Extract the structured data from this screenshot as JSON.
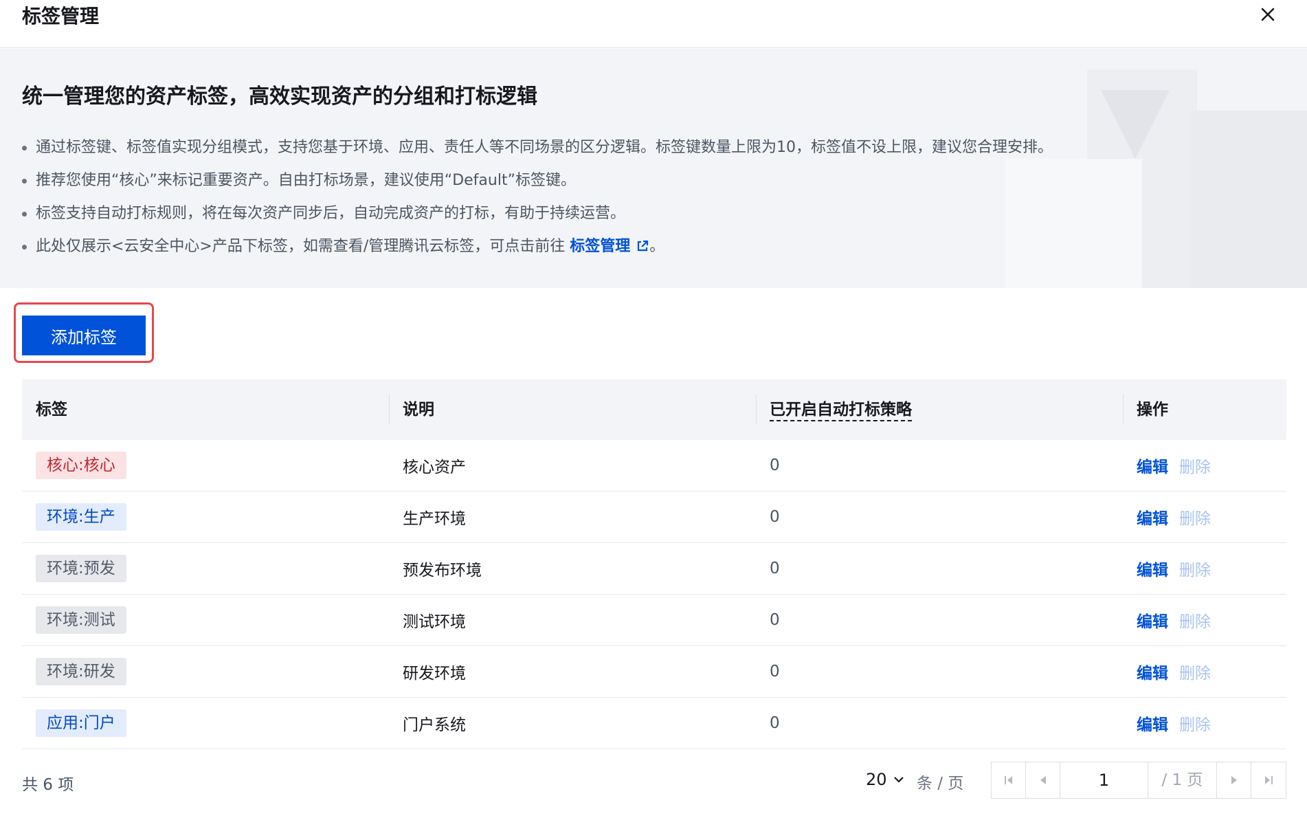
{
  "dialog": {
    "title": "标签管理"
  },
  "banner": {
    "heading": "统一管理您的资产标签，高效实现资产的分组和打标逻辑",
    "bullets": [
      "通过标签键、标签值实现分组模式，支持您基于环境、应用、责任人等不同场景的区分逻辑。标签键数量上限为10，标签值不设上限，建议您合理安排。",
      "推荐您使用“核心”来标记重要资产。自由打标场景，建议使用“Default”标签键。",
      "标签支持自动打标规则，将在每次资产同步后，自动完成资产的打标，有助于持续运营。"
    ],
    "last_bullet_prefix": "此处仅展示<云安全中心>产品下标签，如需查看/管理腾讯云标签，可点击前往 ",
    "last_bullet_link": "标签管理",
    "last_bullet_suffix": "。"
  },
  "toolbar": {
    "add_label": "添加标签"
  },
  "table": {
    "headers": [
      "标签",
      "说明",
      "已开启自动打标策略",
      "操作"
    ],
    "rows": [
      {
        "tag": "核心:核心",
        "tag_color": "red",
        "desc": "核心资产",
        "count": "0",
        "edit": "编辑",
        "delete": "删除"
      },
      {
        "tag": "环境:生产",
        "tag_color": "blue",
        "desc": "生产环境",
        "count": "0",
        "edit": "编辑",
        "delete": "删除"
      },
      {
        "tag": "环境:预发",
        "tag_color": "gray",
        "desc": "预发布环境",
        "count": "0",
        "edit": "编辑",
        "delete": "删除"
      },
      {
        "tag": "环境:测试",
        "tag_color": "gray",
        "desc": "测试环境",
        "count": "0",
        "edit": "编辑",
        "delete": "删除"
      },
      {
        "tag": "环境:研发",
        "tag_color": "gray",
        "desc": "研发环境",
        "count": "0",
        "edit": "编辑",
        "delete": "删除"
      },
      {
        "tag": "应用:门户",
        "tag_color": "blue",
        "desc": "门户系统",
        "count": "0",
        "edit": "编辑",
        "delete": "删除"
      }
    ]
  },
  "pagination": {
    "total": "共 6 项",
    "page_size": "20",
    "per_page_label": "条 / 页",
    "current_page": "1",
    "total_pages": "/ 1 页"
  },
  "colors": {
    "primary": "#0052d9",
    "highlight_border": "#e5484d"
  }
}
